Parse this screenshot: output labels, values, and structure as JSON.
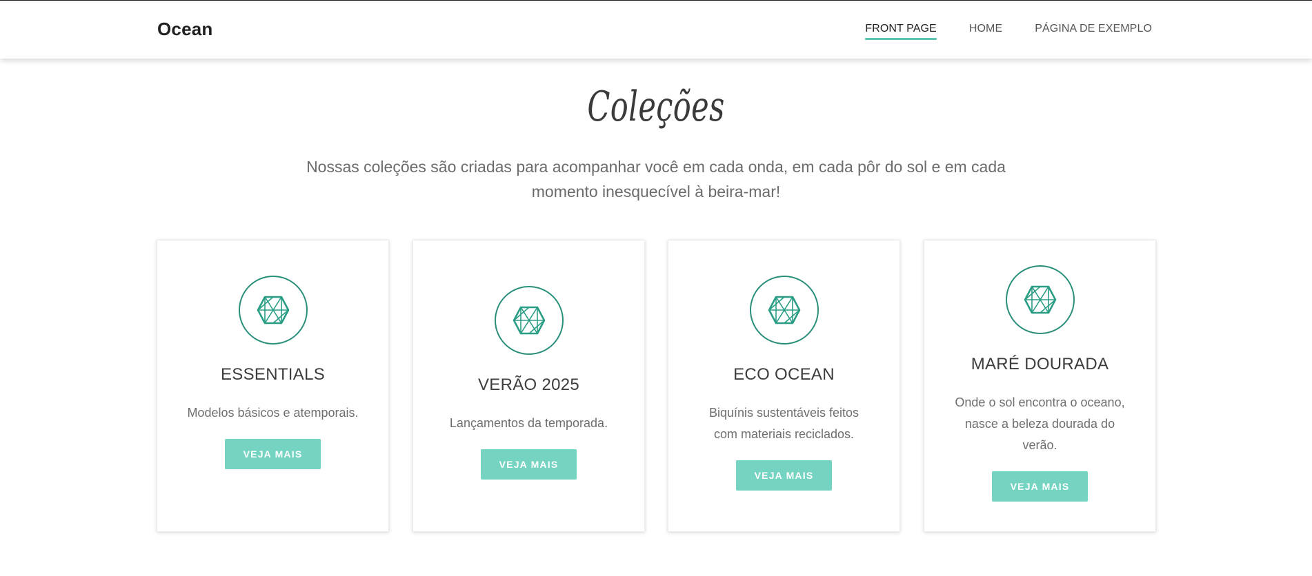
{
  "site": {
    "brand": "Ocean"
  },
  "nav": {
    "items": [
      {
        "label": "FRONT PAGE",
        "active": true
      },
      {
        "label": "HOME",
        "active": false
      },
      {
        "label": "PÁGINA DE EXEMPLO",
        "active": false
      }
    ]
  },
  "section": {
    "title": "Coleções",
    "subtitle": "Nossas coleções são criadas para acompanhar você em cada onda, em cada pôr do sol e em cada momento inesquecível à beira-mar!"
  },
  "cards": [
    {
      "icon": "gem-icon",
      "title": "ESSENTIALS",
      "text": "Modelos básicos e atemporais.",
      "button": "VEJA MAIS"
    },
    {
      "icon": "gem-icon",
      "title": "VERÃO 2025",
      "text": "Lançamentos da temporada.",
      "button": "VEJA MAIS"
    },
    {
      "icon": "gem-icon",
      "title": "ECO OCEAN",
      "text": "Biquínis sustentáveis feitos com materiais reciclados.",
      "button": "VEJA MAIS"
    },
    {
      "icon": "gem-icon",
      "title": "MARÉ DOURADA",
      "text": "Onde o sol encontra o oceano, nasce a beleza dourada do verão.",
      "button": "VEJA MAIS"
    }
  ],
  "colors": {
    "accent": "#5cc6b5",
    "button": "#74d3c1",
    "icon": "#2a9d85"
  }
}
